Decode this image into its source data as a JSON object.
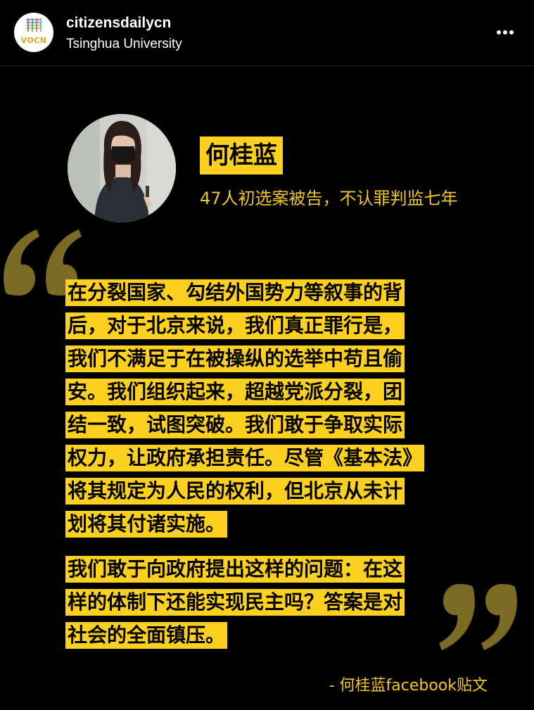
{
  "header": {
    "username": "citizensdailycn",
    "location": "Tsinghua University",
    "avatar_text": "VOCN"
  },
  "post": {
    "name": "何桂蓝",
    "subtitle": "47人初选案被告，不认罪判监七年",
    "paragraph1": [
      "在分裂国家、勾结外国势力等叙事的背",
      "后，对于北京来说，我们真正罪行是，",
      "我们不满足于在被操纵的选举中苟且偷",
      "安。我们组织起来，超越党派分裂，团",
      "结一致，试图突破。我们敢于争取实际",
      "权力，让政府承担责任。尽管《基本法》",
      "将其规定为人民的权利，但北京从未计",
      "划将其付诸实施。"
    ],
    "paragraph2": [
      "我们敢于向政府提出这样的问题：在这",
      "样的体制下还能实现民主吗？答案是对",
      "社会的全面镇压。"
    ],
    "source": "- 何桂蓝facebook贴文"
  },
  "colors": {
    "highlight": "#fcd01f",
    "accent_text": "#f3c623",
    "quote_marks": "#7a6a24",
    "background": "#000000"
  },
  "icons": [
    "more-options-icon",
    "open-quote-icon",
    "close-quote-icon"
  ]
}
